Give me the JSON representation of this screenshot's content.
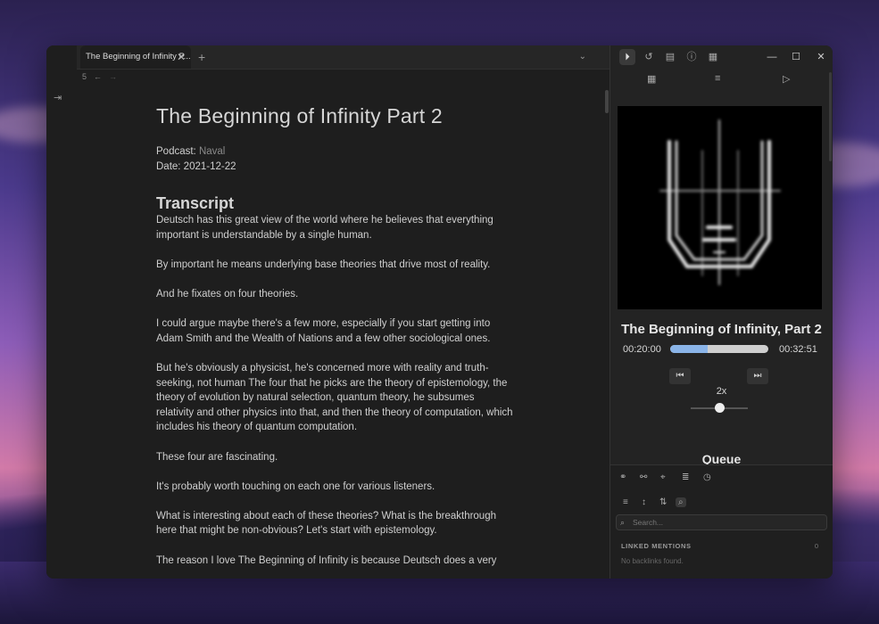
{
  "tab": {
    "title": "The Beginning of Infinity P...",
    "close": "✕",
    "add": "+",
    "list": "⌄"
  },
  "nav": {
    "count": "5",
    "back": "←",
    "forward": "→"
  },
  "document": {
    "title": "The Beginning of Infinity Part 2",
    "podcast_label": "Podcast: ",
    "podcast_value": "Naval",
    "date": "Date: 2021-12-22",
    "section": "Transcript",
    "paragraphs": [
      "Deutsch has this great view of the world where he believes that everything important is understandable by a single human.",
      "By important he means underlying base theories that drive most of reality.",
      "And he fixates on four theories.",
      "I could argue maybe there's a few more, especially if you start getting into Adam Smith and the Wealth of Nations and a few other sociological ones.",
      "But he's obviously a physicist, he's concerned more with reality and truth-seeking, not human The four that he picks are the theory of epistemology, the theory of evolution by natural selection, quantum theory, he subsumes relativity and other physics into that, and then the theory of computation, which includes his theory of quantum computation.",
      "These four are fascinating.",
      "It's probably worth touching on each one for various listeners.",
      "What is interesting about each of these theories? What is the breakthrough here that might be non-obvious? Let's start with epistemology.",
      "The reason I love The Beginning of Infinity is because Deutsch does a very"
    ]
  },
  "player": {
    "episode_title": "The Beginning of Infinity, Part 2",
    "current_time": "00:20:00",
    "total_time": "00:32:51",
    "progress_fraction": 0.38,
    "speed_label": "2x",
    "speed_slider_fraction": 0.5,
    "queue_label": "Queue"
  },
  "backlinks": {
    "search_placeholder": "Search...",
    "linked_mentions_label": "LINKED MENTIONS",
    "linked_mentions_count": "0",
    "empty_text": "No backlinks found."
  },
  "colors": {
    "accent": "#8ab4e8",
    "background": "#1e1e1e"
  }
}
